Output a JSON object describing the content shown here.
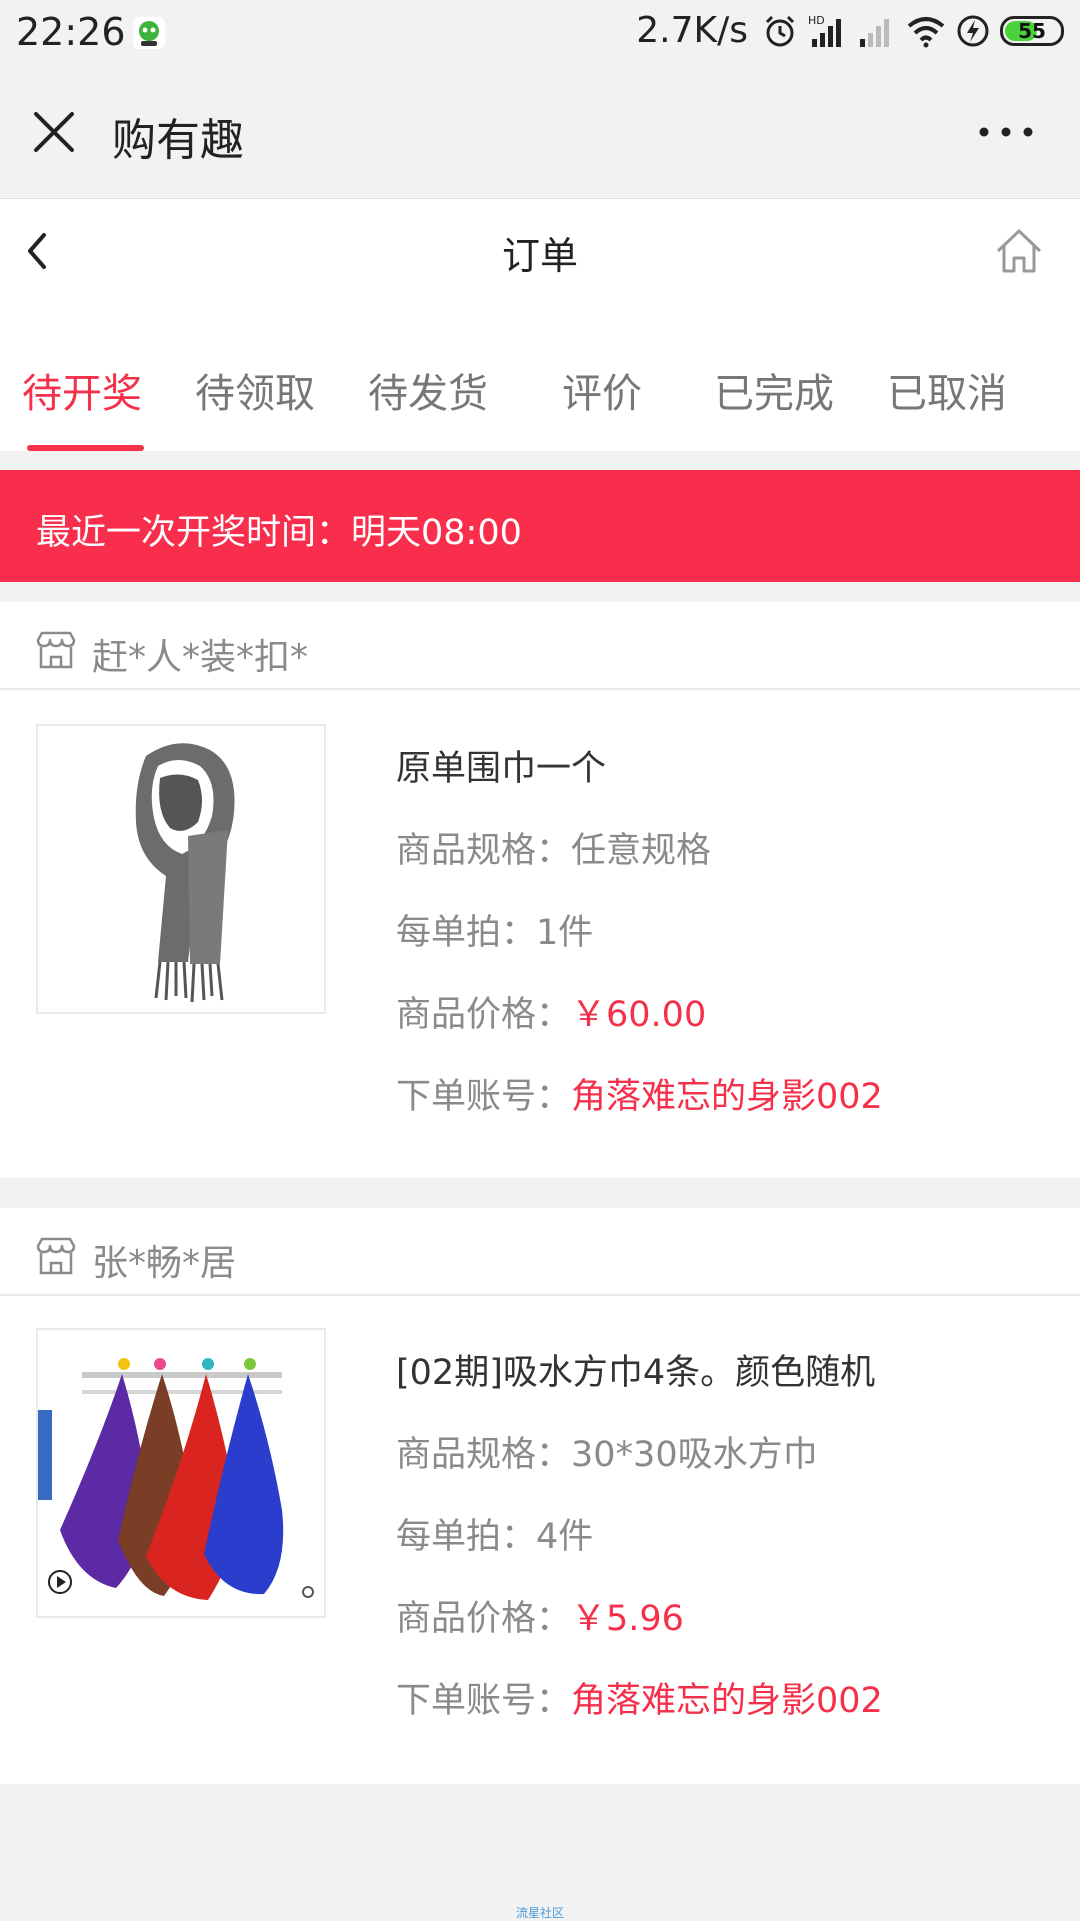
{
  "status_bar": {
    "time": "22:26",
    "net_speed": "2.7K/s",
    "battery": "55",
    "icons": [
      "app-notification-icon",
      "alarm-icon",
      "hd-signal-icon",
      "signal-icon",
      "wifi-icon",
      "charging-icon",
      "battery-icon"
    ]
  },
  "miniprogram": {
    "title": "购有趣"
  },
  "header": {
    "title": "订单"
  },
  "tabs": [
    {
      "label": "待开奖",
      "active": true
    },
    {
      "label": "待领取",
      "active": false
    },
    {
      "label": "待发货",
      "active": false
    },
    {
      "label": "评价",
      "active": false
    },
    {
      "label": "已完成",
      "active": false
    },
    {
      "label": "已取消",
      "active": false
    }
  ],
  "banner": {
    "text": "最近一次开奖时间：明天08:00"
  },
  "orders": [
    {
      "shop": "赶*人*装*扣*",
      "product_name": "原单围巾一个",
      "spec_label": "商品规格：",
      "spec_value": "任意规格",
      "qty_label": "每单拍：",
      "qty_value": "1件",
      "price_label": "商品价格：",
      "price_value": "￥60.00",
      "account_label": "下单账号：",
      "account_value": "角落难忘的身影002"
    },
    {
      "shop": "张*畅*居",
      "product_name": "[02期]吸水方巾4条。颜色随机",
      "spec_label": "商品规格：",
      "spec_value": "30*30吸水方巾",
      "qty_label": "每单拍：",
      "qty_value": "4件",
      "price_label": "商品价格：",
      "price_value": "￥5.96",
      "account_label": "下单账号：",
      "account_value": "角落难忘的身影002"
    }
  ],
  "footer": {
    "watermark": "流星社区"
  },
  "colors": {
    "accent": "#f5304b",
    "banner": "#f82e4c",
    "muted_text": "#8a8a8a",
    "page_bg": "#f2f2f2"
  }
}
